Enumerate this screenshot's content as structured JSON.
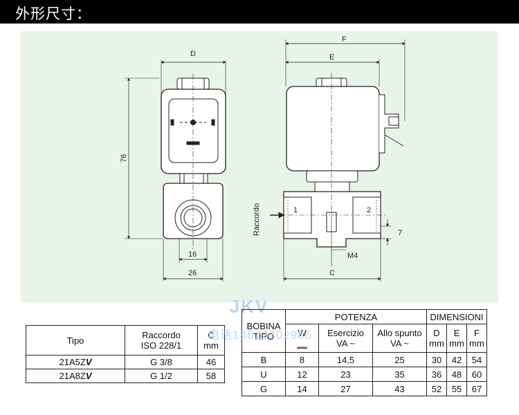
{
  "header": {
    "title": "外形尺寸："
  },
  "drawing": {
    "labels": {
      "D": "D",
      "F": "F",
      "E": "E",
      "C": "C",
      "h76": "76",
      "w16": "16",
      "w26": "26",
      "v7": "7",
      "m4": "M4",
      "raccordo": "Raccordo",
      "port1": "1",
      "port2": "2"
    }
  },
  "watermark": {
    "brand": "JKV",
    "phone": "电话18612702985"
  },
  "table1": {
    "headers": [
      "Tipo",
      "Raccordo\nISO 228/1",
      "C\nmm"
    ],
    "rows": [
      {
        "tipo": "21A5Z",
        "suffix": "V",
        "raccordo": "G 3/8",
        "c": "46"
      },
      {
        "tipo": "21A8Z",
        "suffix": "V",
        "raccordo": "G 1/2",
        "c": "58"
      }
    ]
  },
  "table2": {
    "group_headers": {
      "bobina": "BOBINA\nTIPO",
      "potenza": "POTENZA",
      "dimensioni": "DIMENSIONI"
    },
    "sub_headers": {
      "w": "W\n‗‗",
      "esercizio": "Esercizio\nVA ~",
      "allo_spunto": "Allo spunto\nVA ~",
      "d": "D\nmm",
      "e": "E\nmm",
      "f": "F\nmm"
    },
    "rows": [
      {
        "tipo": "B",
        "w": "8",
        "esercizio": "14,5",
        "spunto": "25",
        "d": "30",
        "e": "42",
        "f": "54"
      },
      {
        "tipo": "U",
        "w": "12",
        "esercizio": "23",
        "spunto": "35",
        "d": "36",
        "e": "48",
        "f": "60"
      },
      {
        "tipo": "G",
        "w": "14",
        "esercizio": "27",
        "spunto": "43",
        "d": "52",
        "e": "55",
        "f": "67"
      }
    ]
  }
}
